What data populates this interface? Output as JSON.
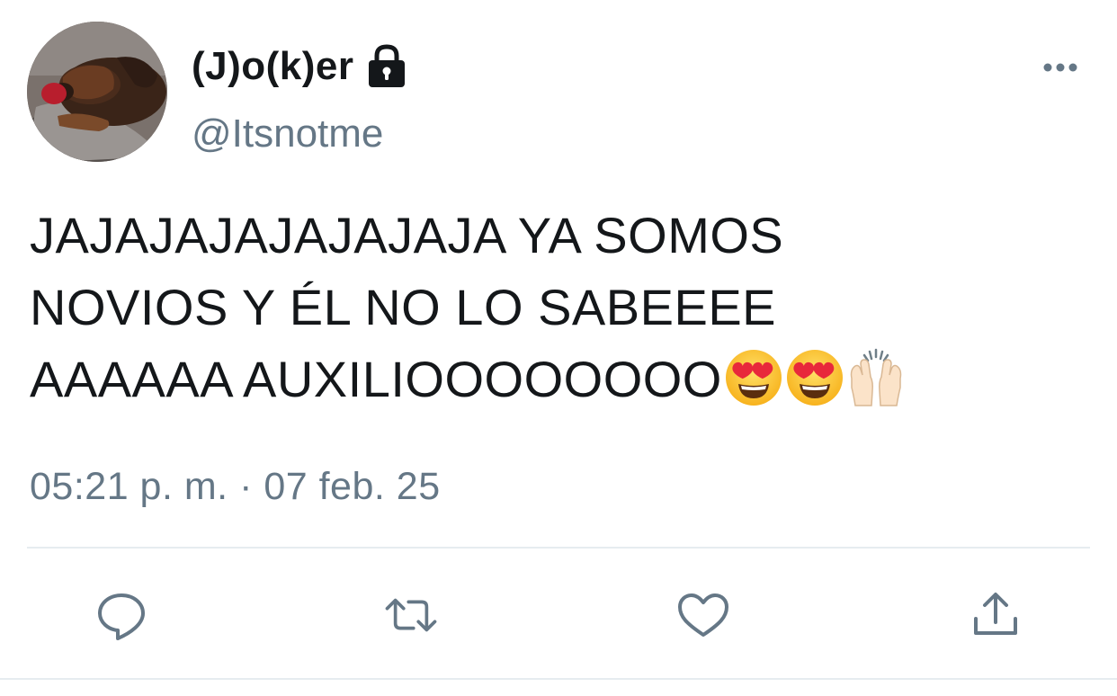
{
  "user": {
    "display_name": "(J)o(k)er",
    "handle": "@Itsnotme",
    "protected": true
  },
  "tweet": {
    "text_lines": [
      "JAJAJAJAJAJAJAJA YA SOMOS",
      "NOVIOS Y ÉL NO LO SABEEEE",
      "AAAAAA AUXILIOOOOOOOO"
    ],
    "emojis": [
      "heart-eyes-emoji",
      "heart-eyes-emoji",
      "raising-hands-emoji"
    ],
    "timestamp": "05:21 p. m. · 07 feb. 25"
  },
  "icons": {
    "lock": "lock-icon",
    "more": "more-dots-icon",
    "reply": "reply-icon",
    "retweet": "retweet-icon",
    "like": "heart-icon",
    "share": "share-icon"
  },
  "colors": {
    "text": "#14171a",
    "secondary": "#657786",
    "divider": "#e6ecf0"
  }
}
